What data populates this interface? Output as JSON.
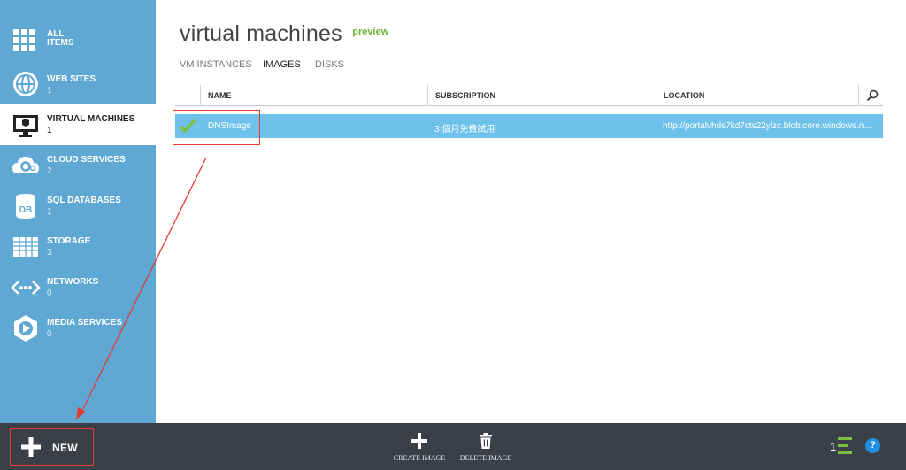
{
  "sidebar": {
    "items": [
      {
        "label": "ALL ITEMS",
        "count": "",
        "icon": "grid-icon"
      },
      {
        "label": "WEB SITES",
        "count": "1",
        "icon": "globe-icon"
      },
      {
        "label": "VIRTUAL MACHINES",
        "count": "1",
        "icon": "monitor-icon",
        "active": true
      },
      {
        "label": "CLOUD SERVICES",
        "count": "2",
        "icon": "cloud-gear-icon"
      },
      {
        "label": "SQL DATABASES",
        "count": "1",
        "icon": "database-icon"
      },
      {
        "label": "STORAGE",
        "count": "3",
        "icon": "table-icon"
      },
      {
        "label": "NETWORKS",
        "count": "0",
        "icon": "network-icon"
      },
      {
        "label": "MEDIA SERVICES",
        "count": "0",
        "icon": "media-play-icon"
      }
    ]
  },
  "header": {
    "title": "virtual machines",
    "badge": "preview"
  },
  "tabs": [
    {
      "label": "VM INSTANCES"
    },
    {
      "label": "IMAGES",
      "active": true
    },
    {
      "label": "DISKS"
    }
  ],
  "grid": {
    "columns": [
      "NAME",
      "SUBSCRIPTION",
      "LOCATION"
    ],
    "rows": [
      {
        "name": "DNSImage",
        "subscription": "3 個月免費試用",
        "location": "http://portalvhds7kd7cts22ylzc.blob.core.windows.n...",
        "status": "check-icon"
      }
    ]
  },
  "bottombar": {
    "new_label": "NEW",
    "commands": [
      {
        "label": "CREATE IMAGE",
        "icon": "plus-icon"
      },
      {
        "label": "DELETE IMAGE",
        "icon": "trash-icon"
      }
    ],
    "operations_count": "1",
    "help_label": "?"
  },
  "colors": {
    "sidebar": "#5fa8d3",
    "selected_row": "#6ec1ea",
    "bottombar": "#3b3f47",
    "preview_green": "#6ab733",
    "highlight_red": "#e53935"
  }
}
